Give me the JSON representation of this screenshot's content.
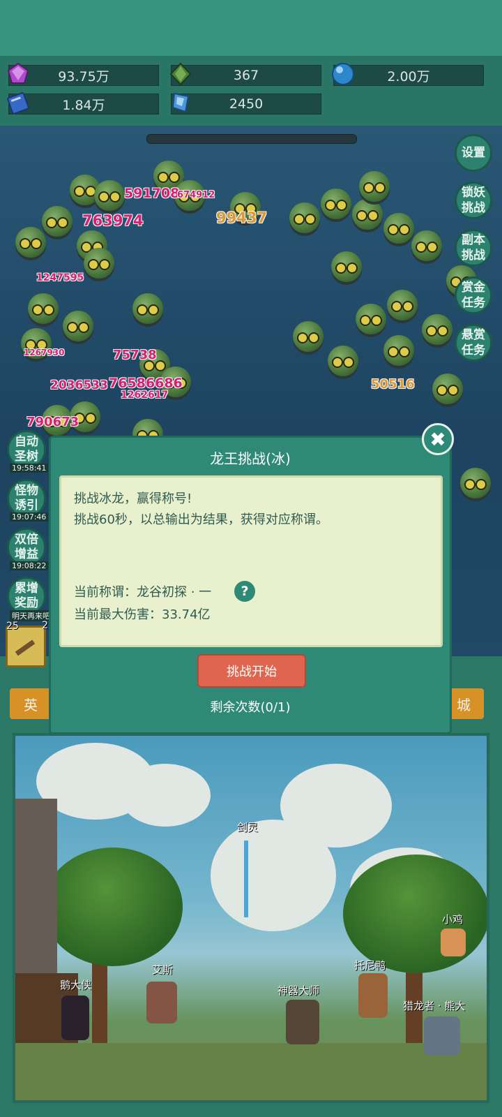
{
  "resources": [
    {
      "icon": "purple-gem-icon",
      "value": "93.75万",
      "color": "#b94fd8"
    },
    {
      "icon": "green-crystal-icon",
      "value": "367",
      "color": "#4e8a3c"
    },
    {
      "icon": "blue-orb-icon",
      "value": "2.00万",
      "color": "#2f8fd8"
    },
    {
      "icon": "blue-book-icon",
      "value": "1.84万",
      "color": "#3a6fd0"
    },
    {
      "icon": "blue-shard-icon",
      "value": "2450",
      "color": "#4fa0e8"
    }
  ],
  "right_menu": [
    "设置",
    "锁妖\n挑战",
    "副本\n挑战",
    "赏金\n任务",
    "悬赏\n任务"
  ],
  "left_menu": [
    {
      "label": "自动\n圣树",
      "timer": "19:58:41"
    },
    {
      "label": "怪物\n诱引",
      "timer": "19:07:46"
    },
    {
      "label": "双倍\n增益",
      "timer": "19:08:22"
    },
    {
      "label": "累增\n奖励",
      "timer": "明天再来吧"
    }
  ],
  "damage_numbers": [
    "591708",
    "674912",
    "763974",
    "99437",
    "1247595",
    "75738",
    "2036533",
    "76586686",
    "1262617",
    "50516",
    "790673",
    "1267930"
  ],
  "slot_counts": [
    "25",
    "2"
  ],
  "tabs": {
    "left": "英",
    "right": "城"
  },
  "dialog": {
    "title": "龙王挑战(冰)",
    "line1": "挑战冰龙，赢得称号!",
    "line2": "挑战60秒，以总输出为结果，获得对应称谓。",
    "title_label": "当前称谓：龙谷初探 · 一",
    "help": "?",
    "max_damage": "当前最大伤害：33.74亿",
    "start_button": "挑战开始",
    "remaining": "剩余次数(0/1)",
    "close": "✖"
  },
  "npcs": [
    "剑灵",
    "艾斯",
    "鹅大侠",
    "神器大师",
    "托尼鸭",
    "小鸡",
    "猎龙者 · 熊大"
  ]
}
